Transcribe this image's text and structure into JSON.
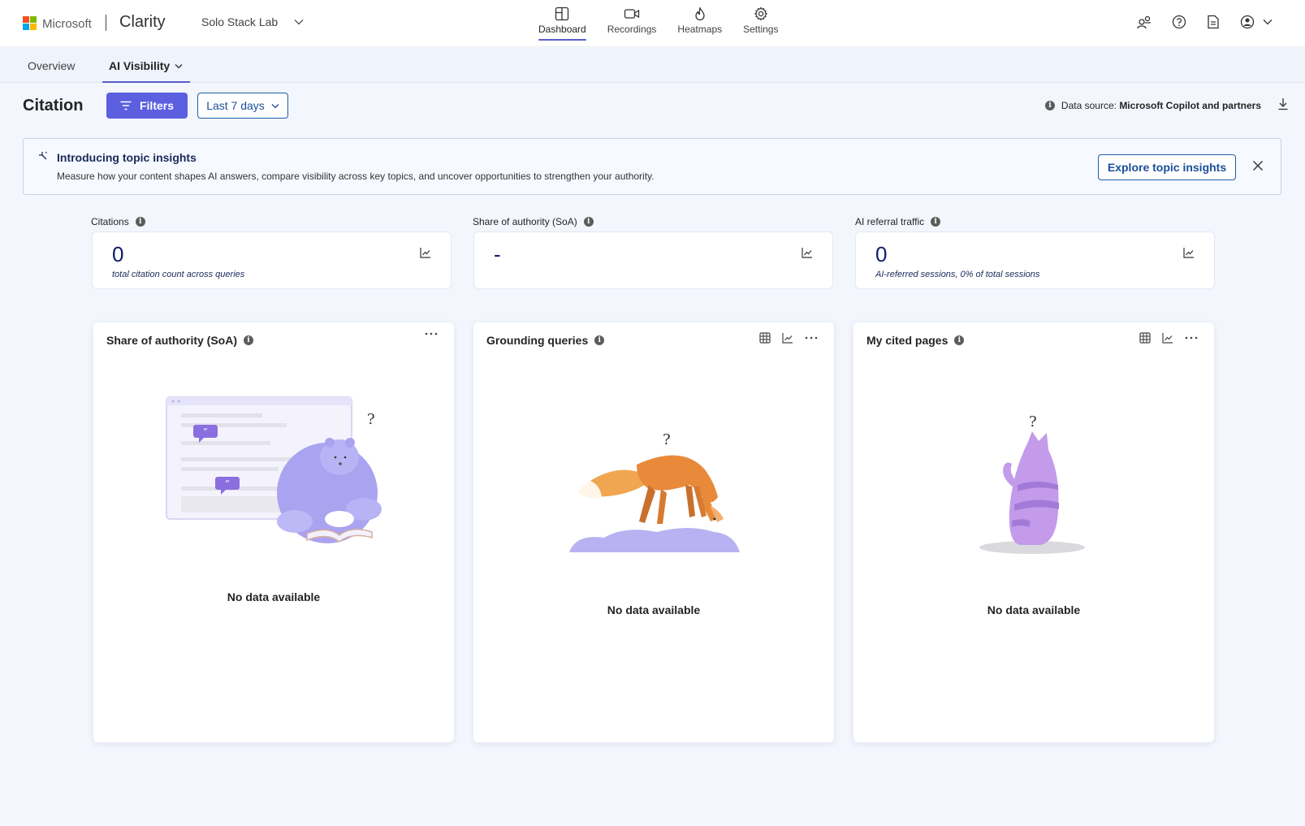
{
  "header": {
    "brand": "Microsoft",
    "product": "Clarity",
    "project": "Solo Stack Lab",
    "nav": [
      {
        "label": "Dashboard",
        "icon": "dashboard-icon",
        "active": true
      },
      {
        "label": "Recordings",
        "icon": "video-icon"
      },
      {
        "label": "Heatmaps",
        "icon": "flame-icon"
      },
      {
        "label": "Settings",
        "icon": "gear-icon"
      }
    ]
  },
  "subtabs": [
    {
      "label": "Overview"
    },
    {
      "label": "AI Visibility",
      "active": true
    }
  ],
  "page": {
    "title": "Citation",
    "filters_label": "Filters",
    "date_range": "Last 7 days",
    "datasource_label": "Data source:",
    "datasource_value": "Microsoft Copilot and partners"
  },
  "banner": {
    "title": "Introducing topic insights",
    "description": "Measure how your content shapes AI answers, compare visibility across key topics, and uncover opportunities to strengthen your authority.",
    "button": "Explore topic insights"
  },
  "kpis": [
    {
      "label": "Citations",
      "value": "0",
      "sub": "total citation count across queries"
    },
    {
      "label": "Share of authority (SoA)",
      "value": "-",
      "sub": ""
    },
    {
      "label": "AI referral traffic",
      "value": "0",
      "sub": "AI-referred sessions, 0% of total sessions"
    }
  ],
  "panels": [
    {
      "title": "Share of authority (SoA)",
      "empty": "No data available",
      "question": "?"
    },
    {
      "title": "Grounding queries",
      "empty": "No data available",
      "question": "?"
    },
    {
      "title": "My cited pages",
      "empty": "No data available",
      "question": "?"
    }
  ],
  "colors": {
    "accent": "#5b5fe0",
    "link": "#1b5fa8",
    "kpi_value": "#0e1b6b",
    "background": "#f3f6fd"
  }
}
